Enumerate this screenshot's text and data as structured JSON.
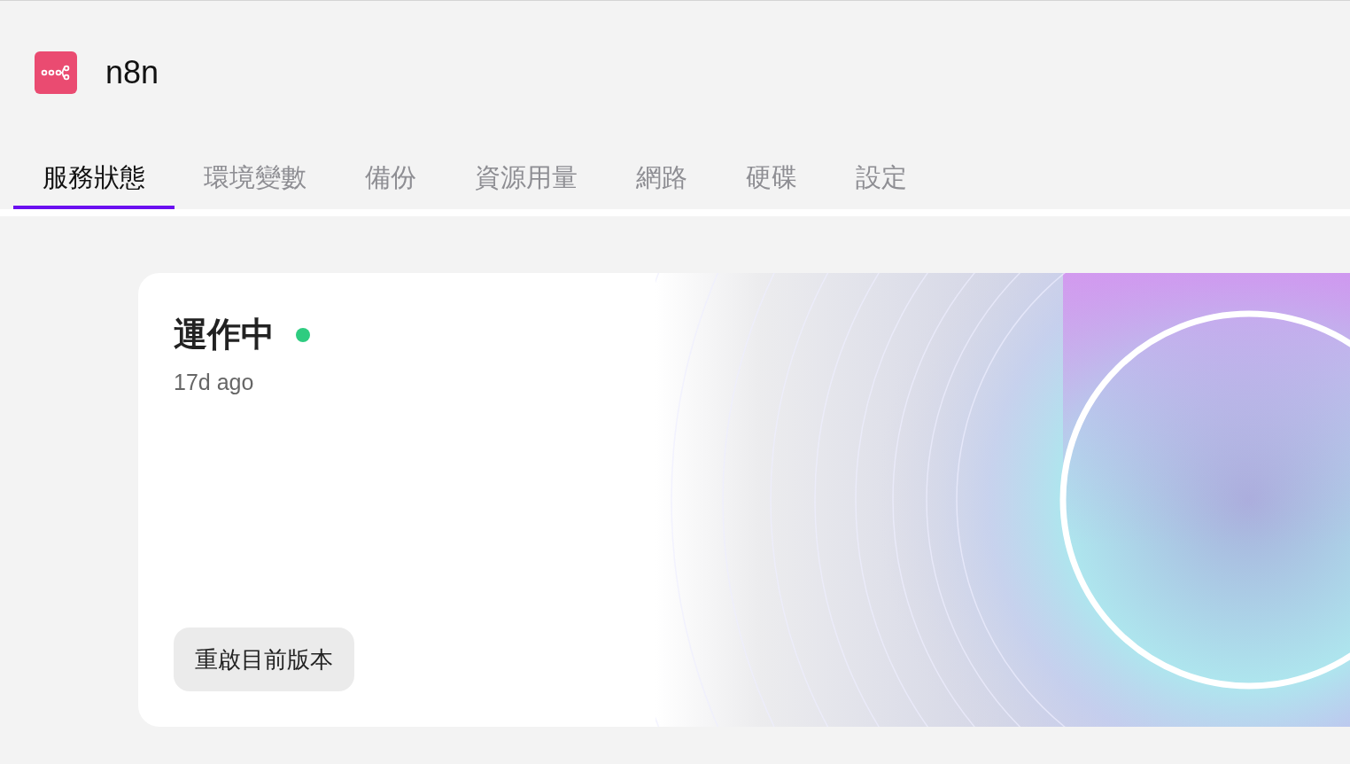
{
  "app": {
    "name": "n8n"
  },
  "tabs": [
    {
      "label": "服務狀態",
      "selected": true
    },
    {
      "label": "環境變數",
      "selected": false
    },
    {
      "label": "備份",
      "selected": false
    },
    {
      "label": "資源用量",
      "selected": false
    },
    {
      "label": "網路",
      "selected": false
    },
    {
      "label": "硬碟",
      "selected": false
    },
    {
      "label": "設定",
      "selected": false
    }
  ],
  "status_card": {
    "title": "運作中",
    "online": true,
    "updated": "17d ago",
    "button": "重啟目前版本"
  }
}
